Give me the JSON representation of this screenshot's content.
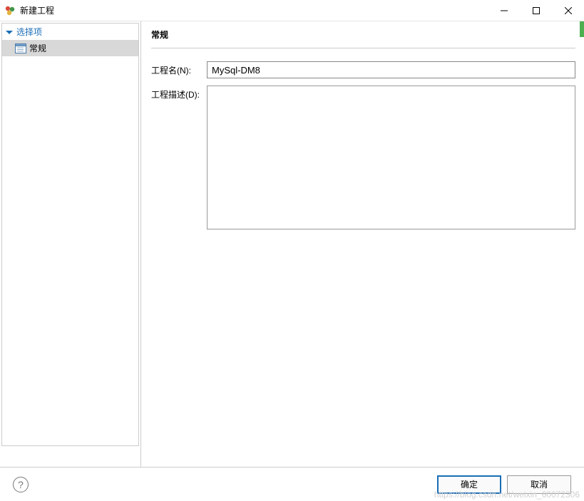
{
  "window": {
    "title": "新建工程"
  },
  "sidebar": {
    "root_label": "选择项",
    "items": [
      {
        "label": "常规"
      }
    ]
  },
  "content": {
    "section_title": "常规",
    "project_name_label": "工程名(N):",
    "project_name_value": "MySql-DM8",
    "project_desc_label": "工程描述(D):",
    "project_desc_value": ""
  },
  "buttons": {
    "ok": "确定",
    "cancel": "取消"
  },
  "watermark": "https://blog.csdn.net/weixin_60072306"
}
